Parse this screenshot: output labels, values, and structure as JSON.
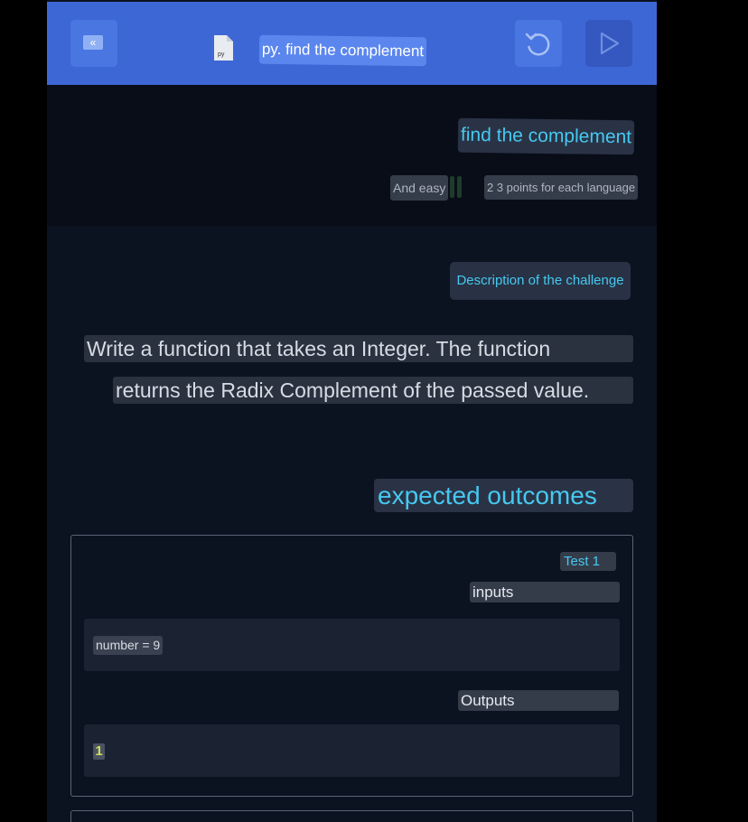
{
  "header": {
    "collapse_glyph": "«",
    "file_type": "py",
    "filename": "py. find the complement"
  },
  "challenge": {
    "title": "find the complement",
    "difficulty": "And easy",
    "points": "2 3 points for each language"
  },
  "description": {
    "heading": "Description of the challenge",
    "line1": "Write a function that takes an Integer. The function",
    "line2": "returns the Radix Complement of the passed value."
  },
  "expected": {
    "heading": "expected outcomes",
    "tests": [
      {
        "label": "Test 1",
        "inputs_label": "inputs",
        "input": "number = 9",
        "outputs_label": "Outputs",
        "output": "1"
      }
    ]
  },
  "colors": {
    "header_bg": "#3e67d6",
    "accent_cyan": "#46c8f0",
    "page_bg": "#0b1220"
  }
}
